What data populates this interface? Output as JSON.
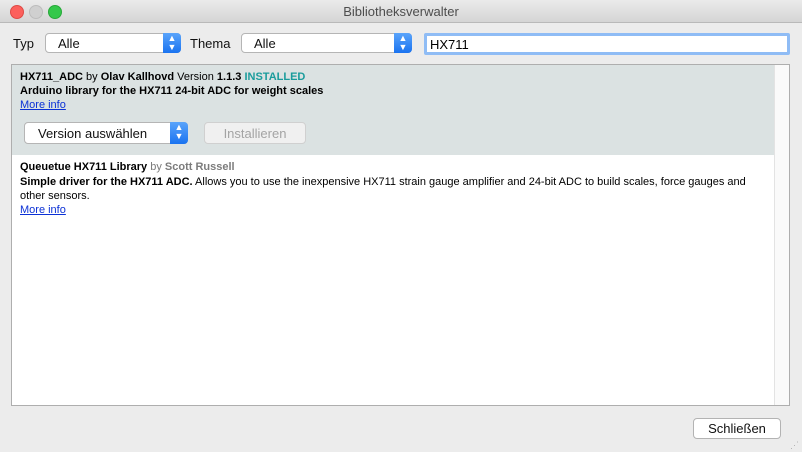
{
  "window": {
    "title": "Bibliotheksverwalter"
  },
  "filters": {
    "type_label": "Typ",
    "type_value": "Alle",
    "topic_label": "Thema",
    "topic_value": "Alle",
    "search_value": "HX711"
  },
  "libraries": [
    {
      "name": "HX711_ADC",
      "by": "by",
      "author": "Olav Kallhovd",
      "version_label": "Version",
      "version": "1.1.3",
      "status": "INSTALLED",
      "description": "Arduino library for the HX711 24-bit ADC for weight scales",
      "more_info": "More info",
      "version_select": "Version auswählen",
      "install_button": "Installieren"
    },
    {
      "name": "Queuetue HX711 Library",
      "by": "by",
      "author": "Scott Russell",
      "description_bold": "Simple driver for the HX711 ADC.",
      "description_rest": " Allows you to use the inexpensive HX711 strain gauge amplifier and 24-bit ADC to build scales, force gauges and other sensors.",
      "more_info": "More info"
    }
  ],
  "footer": {
    "close_button": "Schließen"
  },
  "colors": {
    "installed": "#1a9c9c",
    "link": "#0b31d6",
    "selected_bg": "#dbe2e2"
  }
}
